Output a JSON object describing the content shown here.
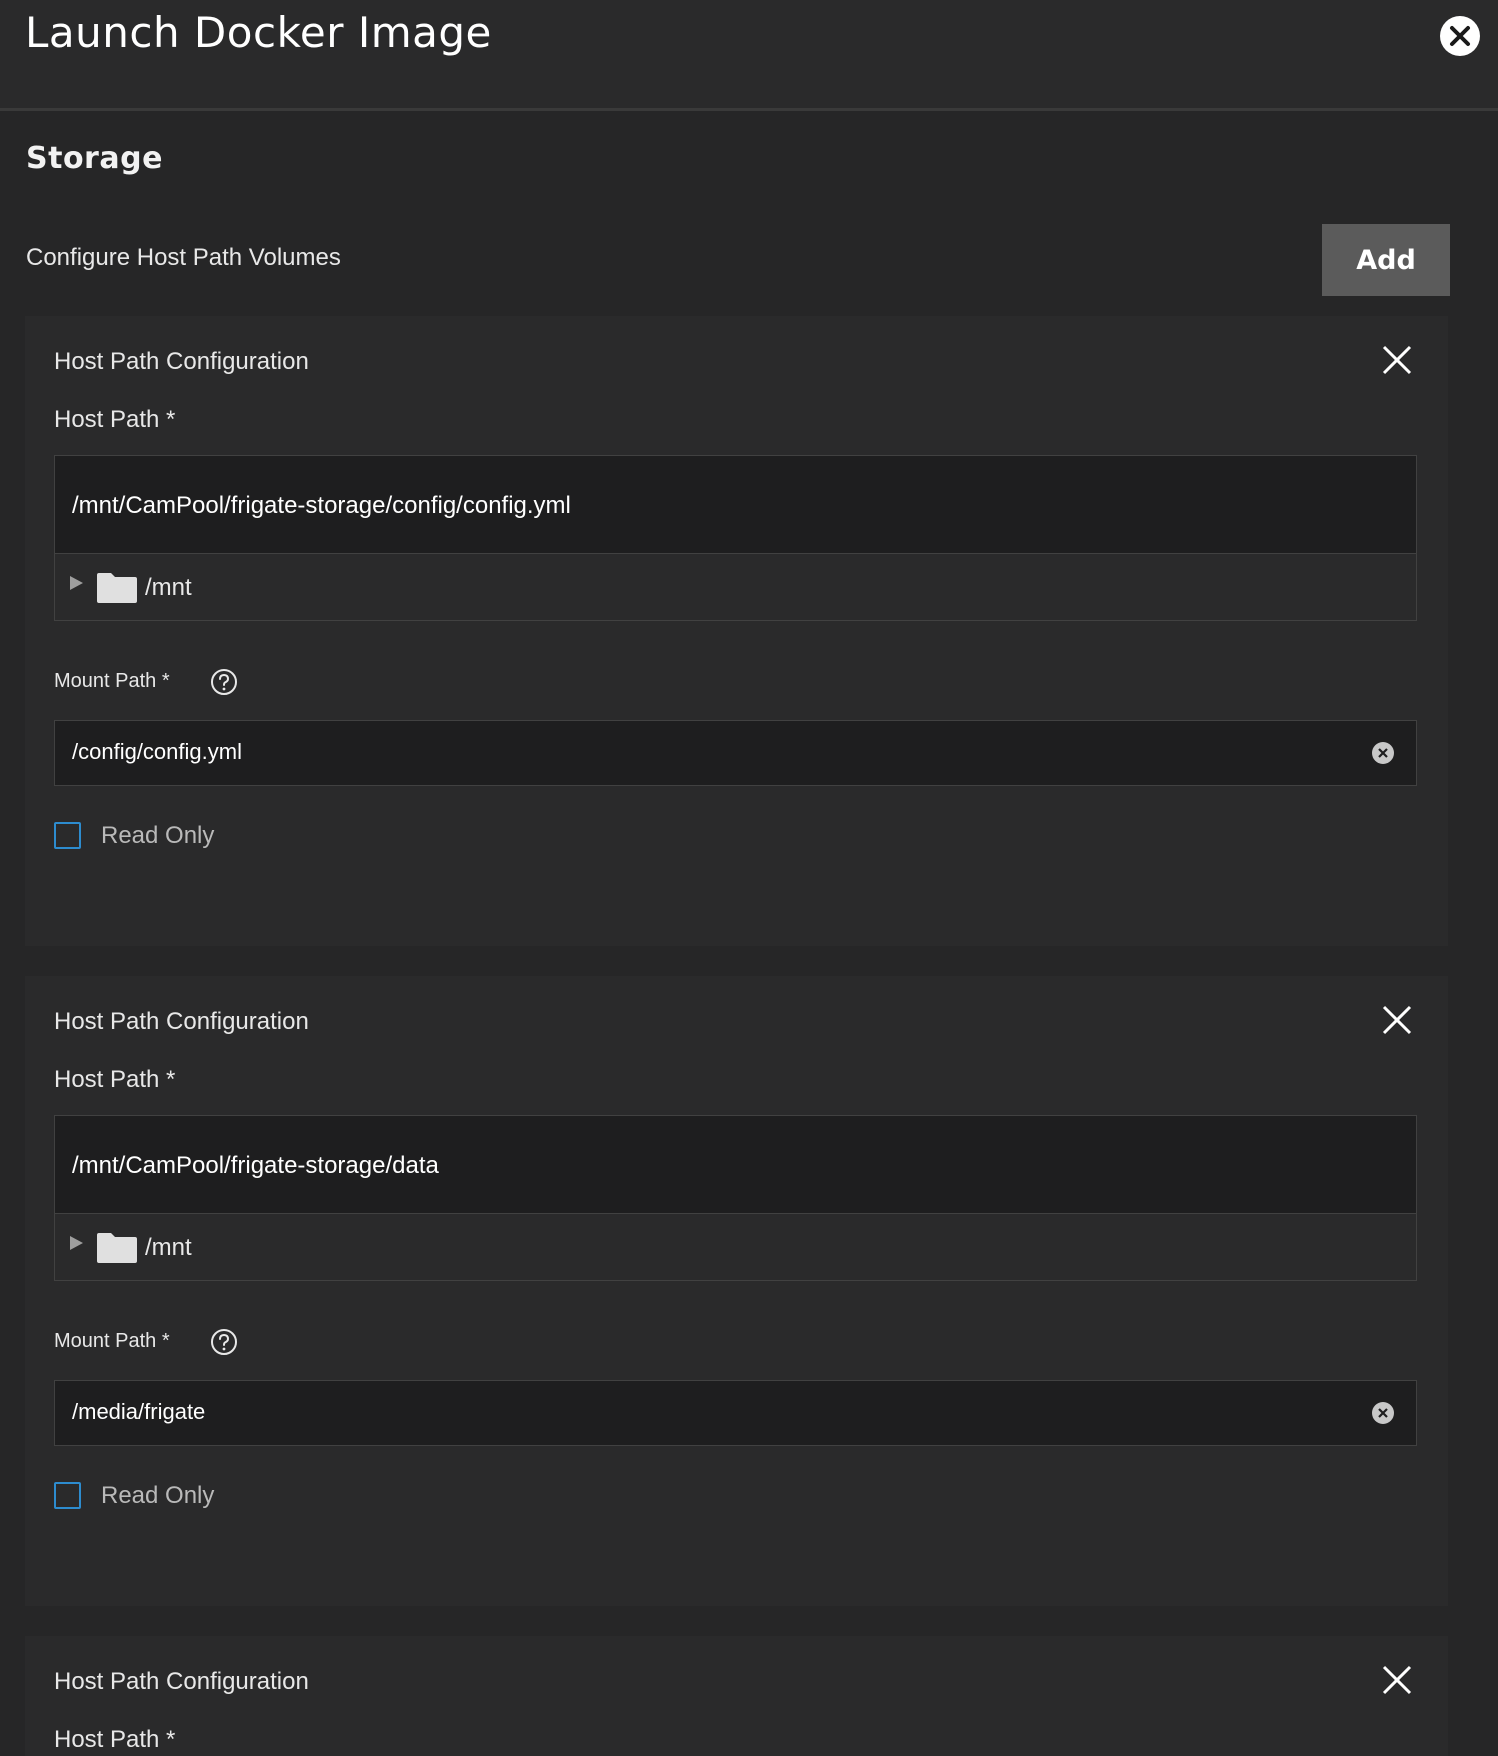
{
  "header": {
    "title": "Launch Docker Image"
  },
  "storage": {
    "section_title": "Storage",
    "configure_label": "Configure Host Path Volumes",
    "add_label": "Add",
    "cards": [
      {
        "title": "Host Path Configuration",
        "host_path_label": "Host Path *",
        "host_path_value": "/mnt/CamPool/frigate-storage/config/config.yml",
        "tree_root": "/mnt",
        "mount_path_label": "Mount Path *",
        "mount_path_value": "/config/config.yml",
        "read_only_label": "Read Only",
        "read_only": false
      },
      {
        "title": "Host Path Configuration",
        "host_path_label": "Host Path *",
        "host_path_value": "/mnt/CamPool/frigate-storage/data",
        "tree_root": "/mnt",
        "mount_path_label": "Mount Path *",
        "mount_path_value": "/media/frigate",
        "read_only_label": "Read Only",
        "read_only": false
      },
      {
        "title": "Host Path Configuration",
        "host_path_label": "Host Path *"
      }
    ]
  },
  "colors": {
    "accent_checkbox": "#2d8ccf",
    "background": "#262627",
    "input_bg": "#1e1e1f",
    "add_button": "#5b5b5b"
  },
  "icons": [
    "close-circle-icon",
    "close-icon",
    "triangle-right-icon",
    "folder-icon",
    "help-circle-icon",
    "clear-circle-icon"
  ]
}
